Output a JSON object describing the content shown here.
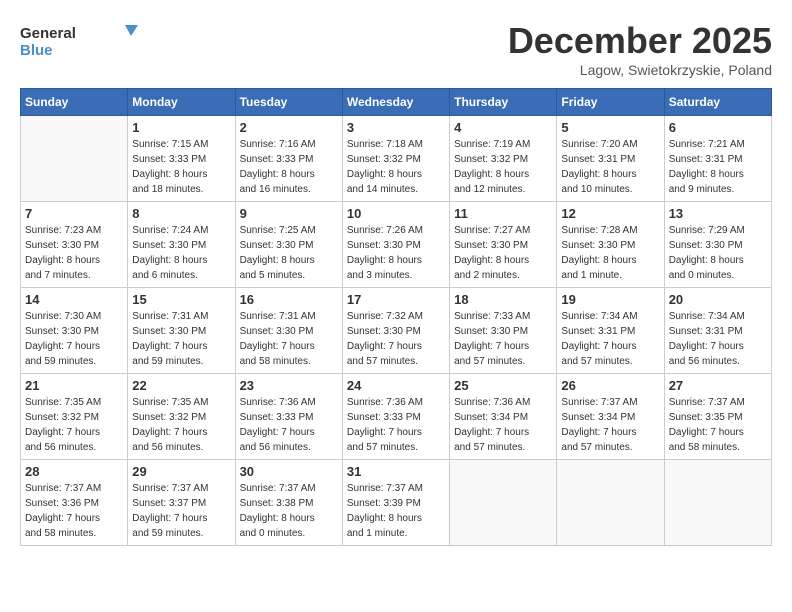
{
  "logo": {
    "line1": "General",
    "line2": "Blue"
  },
  "title": "December 2025",
  "location": "Lagow, Swietokrzyskie, Poland",
  "weekdays": [
    "Sunday",
    "Monday",
    "Tuesday",
    "Wednesday",
    "Thursday",
    "Friday",
    "Saturday"
  ],
  "weeks": [
    [
      {
        "day": "",
        "info": ""
      },
      {
        "day": "1",
        "info": "Sunrise: 7:15 AM\nSunset: 3:33 PM\nDaylight: 8 hours\nand 18 minutes."
      },
      {
        "day": "2",
        "info": "Sunrise: 7:16 AM\nSunset: 3:33 PM\nDaylight: 8 hours\nand 16 minutes."
      },
      {
        "day": "3",
        "info": "Sunrise: 7:18 AM\nSunset: 3:32 PM\nDaylight: 8 hours\nand 14 minutes."
      },
      {
        "day": "4",
        "info": "Sunrise: 7:19 AM\nSunset: 3:32 PM\nDaylight: 8 hours\nand 12 minutes."
      },
      {
        "day": "5",
        "info": "Sunrise: 7:20 AM\nSunset: 3:31 PM\nDaylight: 8 hours\nand 10 minutes."
      },
      {
        "day": "6",
        "info": "Sunrise: 7:21 AM\nSunset: 3:31 PM\nDaylight: 8 hours\nand 9 minutes."
      }
    ],
    [
      {
        "day": "7",
        "info": "Sunrise: 7:23 AM\nSunset: 3:30 PM\nDaylight: 8 hours\nand 7 minutes."
      },
      {
        "day": "8",
        "info": "Sunrise: 7:24 AM\nSunset: 3:30 PM\nDaylight: 8 hours\nand 6 minutes."
      },
      {
        "day": "9",
        "info": "Sunrise: 7:25 AM\nSunset: 3:30 PM\nDaylight: 8 hours\nand 5 minutes."
      },
      {
        "day": "10",
        "info": "Sunrise: 7:26 AM\nSunset: 3:30 PM\nDaylight: 8 hours\nand 3 minutes."
      },
      {
        "day": "11",
        "info": "Sunrise: 7:27 AM\nSunset: 3:30 PM\nDaylight: 8 hours\nand 2 minutes."
      },
      {
        "day": "12",
        "info": "Sunrise: 7:28 AM\nSunset: 3:30 PM\nDaylight: 8 hours\nand 1 minute."
      },
      {
        "day": "13",
        "info": "Sunrise: 7:29 AM\nSunset: 3:30 PM\nDaylight: 8 hours\nand 0 minutes."
      }
    ],
    [
      {
        "day": "14",
        "info": "Sunrise: 7:30 AM\nSunset: 3:30 PM\nDaylight: 7 hours\nand 59 minutes."
      },
      {
        "day": "15",
        "info": "Sunrise: 7:31 AM\nSunset: 3:30 PM\nDaylight: 7 hours\nand 59 minutes."
      },
      {
        "day": "16",
        "info": "Sunrise: 7:31 AM\nSunset: 3:30 PM\nDaylight: 7 hours\nand 58 minutes."
      },
      {
        "day": "17",
        "info": "Sunrise: 7:32 AM\nSunset: 3:30 PM\nDaylight: 7 hours\nand 57 minutes."
      },
      {
        "day": "18",
        "info": "Sunrise: 7:33 AM\nSunset: 3:30 PM\nDaylight: 7 hours\nand 57 minutes."
      },
      {
        "day": "19",
        "info": "Sunrise: 7:34 AM\nSunset: 3:31 PM\nDaylight: 7 hours\nand 57 minutes."
      },
      {
        "day": "20",
        "info": "Sunrise: 7:34 AM\nSunset: 3:31 PM\nDaylight: 7 hours\nand 56 minutes."
      }
    ],
    [
      {
        "day": "21",
        "info": "Sunrise: 7:35 AM\nSunset: 3:32 PM\nDaylight: 7 hours\nand 56 minutes."
      },
      {
        "day": "22",
        "info": "Sunrise: 7:35 AM\nSunset: 3:32 PM\nDaylight: 7 hours\nand 56 minutes."
      },
      {
        "day": "23",
        "info": "Sunrise: 7:36 AM\nSunset: 3:33 PM\nDaylight: 7 hours\nand 56 minutes."
      },
      {
        "day": "24",
        "info": "Sunrise: 7:36 AM\nSunset: 3:33 PM\nDaylight: 7 hours\nand 57 minutes."
      },
      {
        "day": "25",
        "info": "Sunrise: 7:36 AM\nSunset: 3:34 PM\nDaylight: 7 hours\nand 57 minutes."
      },
      {
        "day": "26",
        "info": "Sunrise: 7:37 AM\nSunset: 3:34 PM\nDaylight: 7 hours\nand 57 minutes."
      },
      {
        "day": "27",
        "info": "Sunrise: 7:37 AM\nSunset: 3:35 PM\nDaylight: 7 hours\nand 58 minutes."
      }
    ],
    [
      {
        "day": "28",
        "info": "Sunrise: 7:37 AM\nSunset: 3:36 PM\nDaylight: 7 hours\nand 58 minutes."
      },
      {
        "day": "29",
        "info": "Sunrise: 7:37 AM\nSunset: 3:37 PM\nDaylight: 7 hours\nand 59 minutes."
      },
      {
        "day": "30",
        "info": "Sunrise: 7:37 AM\nSunset: 3:38 PM\nDaylight: 8 hours\nand 0 minutes."
      },
      {
        "day": "31",
        "info": "Sunrise: 7:37 AM\nSunset: 3:39 PM\nDaylight: 8 hours\nand 1 minute."
      },
      {
        "day": "",
        "info": ""
      },
      {
        "day": "",
        "info": ""
      },
      {
        "day": "",
        "info": ""
      }
    ]
  ]
}
